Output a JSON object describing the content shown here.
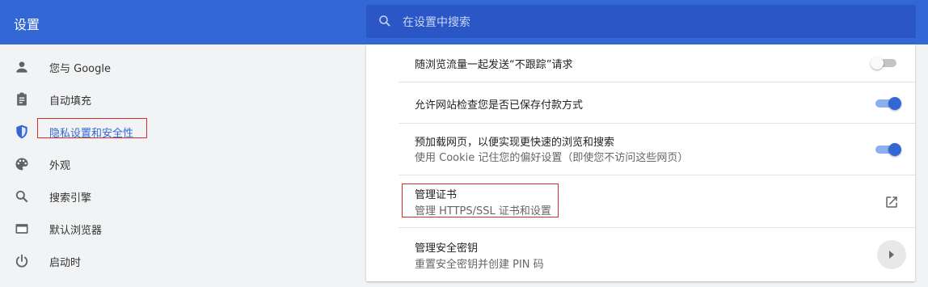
{
  "header": {
    "title": "设置",
    "search_placeholder": "在设置中搜索"
  },
  "sidebar": {
    "items": [
      {
        "label": "您与 Google",
        "icon": "person-icon"
      },
      {
        "label": "自动填充",
        "icon": "clipboard-icon"
      },
      {
        "label": "隐私设置和安全性",
        "icon": "shield-icon",
        "active": true
      },
      {
        "label": "外观",
        "icon": "palette-icon"
      },
      {
        "label": "搜索引擎",
        "icon": "search-icon"
      },
      {
        "label": "默认浏览器",
        "icon": "browser-window-icon"
      },
      {
        "label": "启动时",
        "icon": "power-icon"
      }
    ]
  },
  "settings": {
    "do_not_track": {
      "title": "随浏览流量一起发送“不跟踪”请求",
      "enabled": false
    },
    "payment_check": {
      "title": "允许网站检查您是否已保存付款方式",
      "enabled": true
    },
    "preload": {
      "title": "预加载网页，以便实现更快速的浏览和搜索",
      "subtitle": "使用 Cookie 记住您的偏好设置（即使您不访问这些网页）",
      "enabled": true
    },
    "certificates": {
      "title": "管理证书",
      "subtitle": "管理 HTTPS/SSL 证书和设置",
      "icon": "open-in-new-icon"
    },
    "security_keys": {
      "title": "管理安全密钥",
      "subtitle": "重置安全密钥并创建 PIN 码",
      "icon": "arrow-right-icon"
    }
  },
  "colors": {
    "header_bg": "#3367d6",
    "accent": "#3367d6",
    "highlight_box": "#d32f2f"
  }
}
